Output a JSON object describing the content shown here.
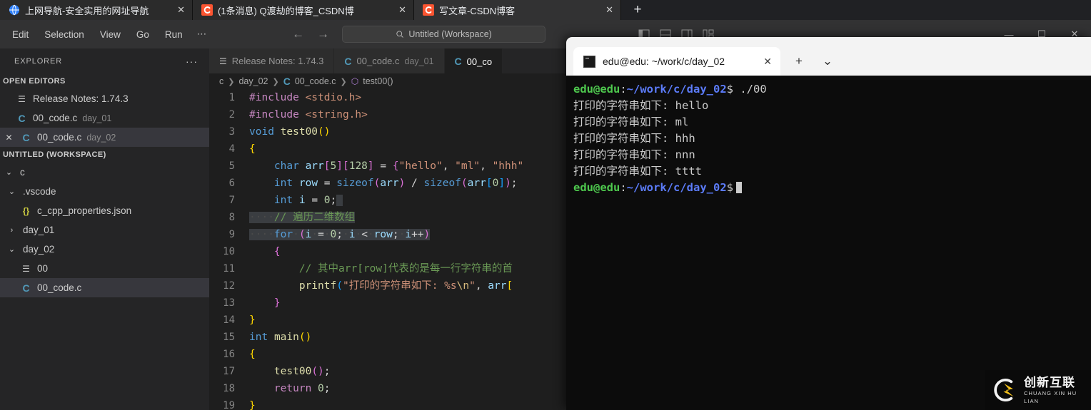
{
  "browser": {
    "tabs": [
      {
        "title": "上网导航-安全实用的网址导航",
        "favicon": "globe-icon",
        "close": "✕",
        "active": false
      },
      {
        "title": "(1条消息) Q渡劫的博客_CSDN博",
        "favicon": "csdn-icon",
        "close": "✕",
        "active": false
      },
      {
        "title": "写文章-CSDN博客",
        "favicon": "csdn-icon",
        "close": "✕",
        "active": true
      }
    ],
    "new_tab_label": "+"
  },
  "vscode": {
    "menu": [
      "Edit",
      "Selection",
      "View",
      "Go",
      "Run",
      "⋯"
    ],
    "nav": {
      "back": "←",
      "forward": "→"
    },
    "quick_open": {
      "icon": "search-icon",
      "text": "Untitled (Workspace)"
    },
    "window_controls": {
      "minimize": "—",
      "maximize": "☐",
      "close": "✕"
    },
    "sidebar": {
      "header": {
        "title": "EXPLORER",
        "more": "···"
      },
      "open_editors": {
        "title": "OPEN EDITORS",
        "items": [
          {
            "icon": "lines-icon",
            "label": "Release Notes: 1.74.3",
            "suffix": "",
            "selected": false,
            "close": ""
          },
          {
            "icon": "c-file-icon",
            "label": "00_code.c",
            "suffix": "day_01",
            "selected": false,
            "close": ""
          },
          {
            "icon": "c-file-icon",
            "label": "00_code.c",
            "suffix": "day_02",
            "selected": true,
            "close": "✕"
          }
        ]
      },
      "workspace": {
        "title": "UNTITLED (WORKSPACE)",
        "items": [
          {
            "chevron": "⌄",
            "icon": "",
            "label": "c",
            "indent": 0,
            "selected": false
          },
          {
            "chevron": "⌄",
            "icon": "",
            "label": ".vscode",
            "indent": 1,
            "selected": false
          },
          {
            "chevron": "",
            "icon": "json-icon",
            "label": "c_cpp_properties.json",
            "indent": 2,
            "selected": false
          },
          {
            "chevron": "›",
            "icon": "",
            "label": "day_01",
            "indent": 1,
            "selected": false
          },
          {
            "chevron": "⌄",
            "icon": "",
            "label": "day_02",
            "indent": 1,
            "selected": false
          },
          {
            "chevron": "",
            "icon": "lines-icon",
            "label": "00",
            "indent": 2,
            "selected": false
          },
          {
            "chevron": "",
            "icon": "c-file-icon",
            "label": "00_code.c",
            "indent": 2,
            "selected": true
          }
        ]
      }
    },
    "editor_tabs": [
      {
        "icon": "lines-icon",
        "label": "Release Notes: 1.74.3",
        "suffix": "",
        "active": false
      },
      {
        "icon": "c-file-icon",
        "label": "00_code.c",
        "suffix": "day_01",
        "active": false
      },
      {
        "icon": "c-file-icon",
        "label": "00_co",
        "suffix": "",
        "active": true
      }
    ],
    "breadcrumb": [
      "c",
      "day_02",
      "00_code.c",
      "test00()"
    ],
    "code_lines": [
      {
        "n": 1,
        "text": "#include <stdio.h>"
      },
      {
        "n": 2,
        "text": "#include <string.h>"
      },
      {
        "n": 3,
        "text": "void test00()"
      },
      {
        "n": 4,
        "text": "{"
      },
      {
        "n": 5,
        "text": "    char arr[5][128] = {\"hello\", \"ml\", \"hhh\""
      },
      {
        "n": 6,
        "text": "    int row = sizeof(arr) / sizeof(arr[0]);"
      },
      {
        "n": 7,
        "text": "    int i = 0;"
      },
      {
        "n": 8,
        "text": "    // 遍历二维数组"
      },
      {
        "n": 9,
        "text": "    for (i = 0; i < row; i++)"
      },
      {
        "n": 10,
        "text": "    {"
      },
      {
        "n": 11,
        "text": "        // 其中arr[row]代表的是每一行字符串的首"
      },
      {
        "n": 12,
        "text": "        printf(\"打印的字符串如下: %s\\n\", arr["
      },
      {
        "n": 13,
        "text": "    }"
      },
      {
        "n": 14,
        "text": "}"
      },
      {
        "n": 15,
        "text": "int main()"
      },
      {
        "n": 16,
        "text": "{"
      },
      {
        "n": 17,
        "text": "    test00();"
      },
      {
        "n": 18,
        "text": "    return 0;"
      },
      {
        "n": 19,
        "text": "}"
      }
    ]
  },
  "terminal": {
    "tab_title": "edu@edu: ~/work/c/day_02",
    "tab_icon": "terminal-icon",
    "tab_close": "✕",
    "new_tab": "+",
    "dropdown": "⌄",
    "prompt_user": "edu@edu",
    "prompt_path": "~/work/c/day_02",
    "prompt_symbol": "$",
    "command": "./00",
    "output_lines": [
      "打印的字符串如下: hello",
      "打印的字符串如下: ml",
      "打印的字符串如下: hhh",
      "打印的字符串如下: nnn",
      "打印的字符串如下: tttt"
    ]
  },
  "watermark": {
    "cn": "创新互联",
    "en": "CHUANG XIN HU LIAN",
    "logo": "cx-logo-icon"
  },
  "colors": {
    "vscode_bg": "#1e1e1e",
    "sidebar_bg": "#252526",
    "titlebar_bg": "#323233",
    "accent_blue": "#519aba",
    "terminal_bg": "#0c0c0c",
    "prompt_green": "#4ec94e",
    "prompt_blue": "#5c7cfa"
  }
}
